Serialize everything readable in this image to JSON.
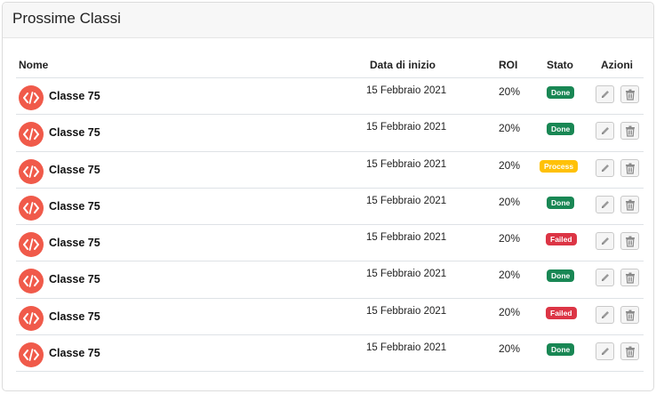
{
  "card": {
    "title": "Prossime Classi"
  },
  "table": {
    "headers": {
      "name": "Nome",
      "date": "Data di inizio",
      "roi": "ROI",
      "status": "Stato",
      "actions": "Azioni"
    },
    "rows": [
      {
        "name": "Classe 75",
        "date": "15 Febbraio 2021",
        "roi": "20%",
        "status": "Done",
        "status_type": "done"
      },
      {
        "name": "Classe 75",
        "date": "15 Febbraio 2021",
        "roi": "20%",
        "status": "Done",
        "status_type": "done"
      },
      {
        "name": "Classe 75",
        "date": "15 Febbraio 2021",
        "roi": "20%",
        "status": "Process",
        "status_type": "process"
      },
      {
        "name": "Classe 75",
        "date": "15 Febbraio 2021",
        "roi": "20%",
        "status": "Done",
        "status_type": "done"
      },
      {
        "name": "Classe 75",
        "date": "15 Febbraio 2021",
        "roi": "20%",
        "status": "Failed",
        "status_type": "failed"
      },
      {
        "name": "Classe 75",
        "date": "15 Febbraio 2021",
        "roi": "20%",
        "status": "Done",
        "status_type": "done"
      },
      {
        "name": "Classe 75",
        "date": "15 Febbraio 2021",
        "roi": "20%",
        "status": "Failed",
        "status_type": "failed"
      },
      {
        "name": "Classe 75",
        "date": "15 Febbraio 2021",
        "roi": "20%",
        "status": "Done",
        "status_type": "done"
      }
    ]
  },
  "icons": {
    "avatar": "code-icon",
    "edit": "pencil-icon",
    "delete": "trash-icon"
  },
  "colors": {
    "avatar": "#f05a4a",
    "done": "#198754",
    "process": "#ffc107",
    "failed": "#dc3545"
  }
}
